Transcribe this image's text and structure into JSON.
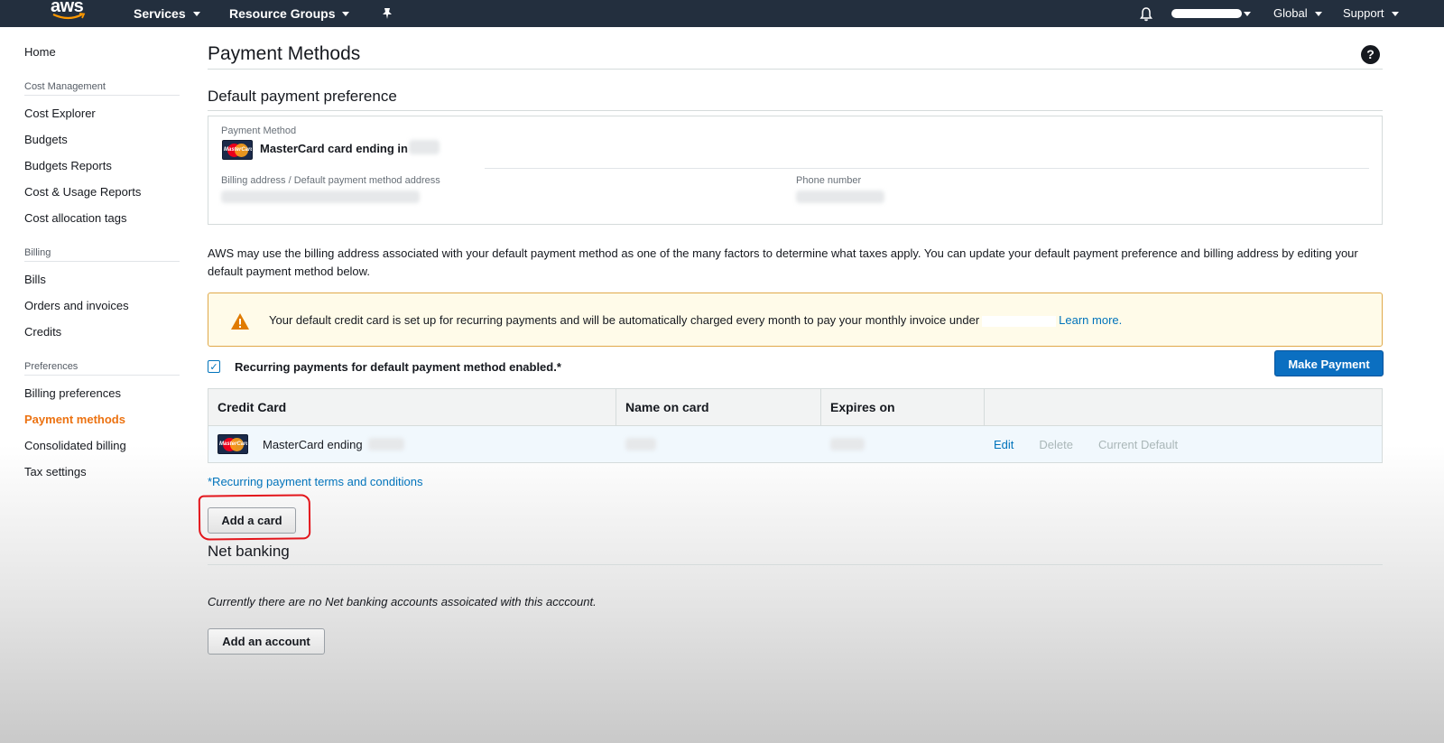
{
  "topnav": {
    "logo_text": "aws",
    "services": "Services",
    "resource_groups": "Resource Groups",
    "region": "Global",
    "support": "Support"
  },
  "sidebar": {
    "home": "Home",
    "sections": [
      {
        "label": "Cost Management",
        "items": [
          "Cost Explorer",
          "Budgets",
          "Budgets Reports",
          "Cost & Usage Reports",
          "Cost allocation tags"
        ]
      },
      {
        "label": "Billing",
        "items": [
          "Bills",
          "Orders and invoices",
          "Credits"
        ]
      },
      {
        "label": "Preferences",
        "items": [
          "Billing preferences",
          "Payment methods",
          "Consolidated billing",
          "Tax settings"
        ]
      }
    ],
    "active_item": "Payment methods"
  },
  "main": {
    "title": "Payment Methods",
    "help_glyph": "?",
    "default_pref": {
      "heading": "Default payment preference",
      "payment_method_label": "Payment Method",
      "card_text": "MasterCard card ending in",
      "billing_address_label": "Billing address / Default payment method address",
      "phone_label": "Phone number"
    },
    "tax_note": "AWS may use the billing address associated with your default payment method as one of the many factors to determine what taxes apply. You can update your default payment preference and billing address by editing your default payment method below.",
    "alert": {
      "text": "Your default credit card is set up for recurring payments and will be automatically charged every month to pay your monthly invoice under",
      "link": "Learn more."
    },
    "recurring": {
      "checked": true,
      "label": "Recurring payments for default payment method enabled.*"
    },
    "make_payment": "Make Payment",
    "table": {
      "headers": [
        "Credit Card",
        "Name on card",
        "Expires on",
        ""
      ],
      "rows": [
        {
          "card": "MasterCard ending",
          "actions": {
            "edit": "Edit",
            "delete": "Delete",
            "default": "Current Default"
          }
        }
      ]
    },
    "terms_link": "*Recurring payment terms and conditions",
    "add_card": "Add a card",
    "net_banking": {
      "heading": "Net banking",
      "note": "Currently there are no Net banking accounts assoicated with this acccount.",
      "add_account": "Add an account"
    }
  },
  "colors": {
    "nav_bg": "#232f3e",
    "active_orange": "#ec7211",
    "link_blue": "#0073bb",
    "primary_button": "#0b6fc1",
    "alert_bg": "#fffbe9",
    "highlight_red": "#e3161c"
  },
  "icons": {
    "bell": "bell-icon",
    "pin": "pin-icon",
    "help": "help-icon",
    "warning": "warning-icon",
    "card": "mastercard-icon"
  }
}
